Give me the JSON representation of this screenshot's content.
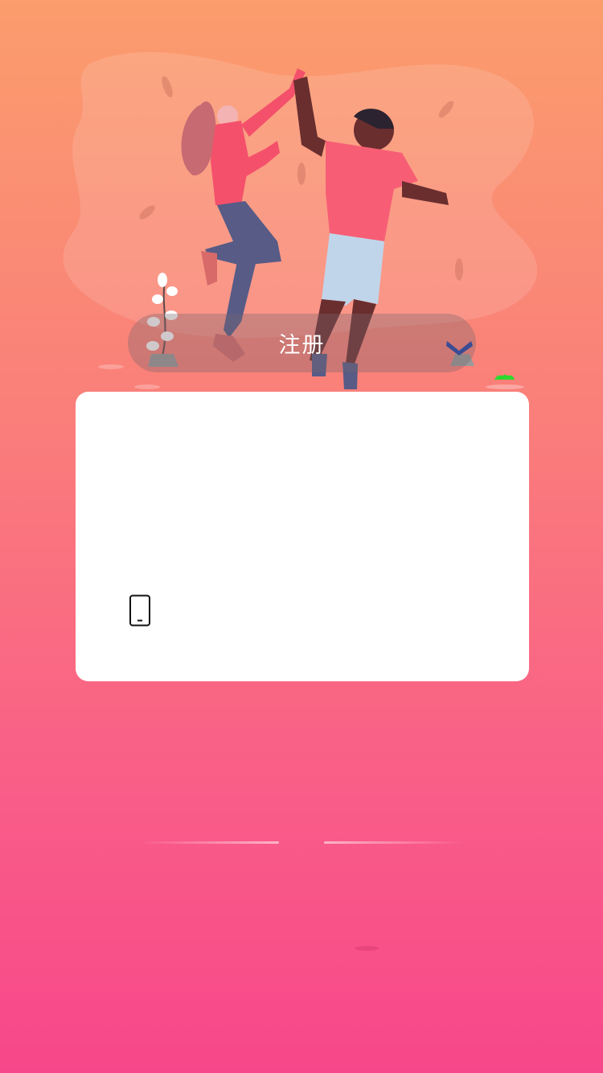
{
  "header": {
    "register_label": "注册"
  },
  "form": {
    "phone_placeholder": ""
  },
  "icons": {
    "phone": "smartphone-icon",
    "logo": "v-logo-icon",
    "grass": "grass-icon"
  },
  "colors": {
    "gradient_top": "#fb9d6c",
    "gradient_bottom": "#f7478a",
    "card": "#ffffff"
  }
}
